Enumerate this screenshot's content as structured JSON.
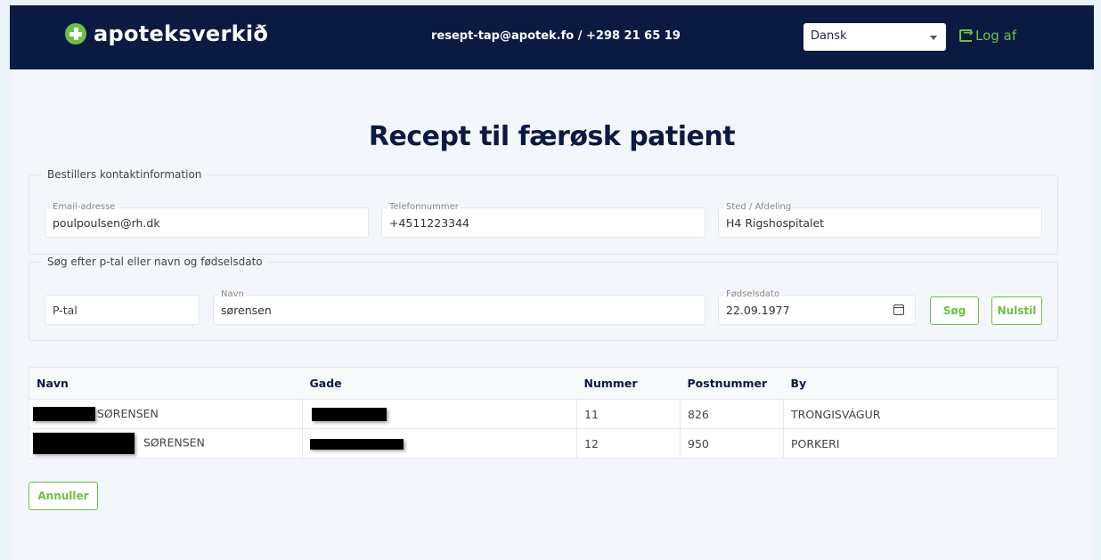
{
  "header": {
    "brand": "apoteksverkið",
    "contact": "resept-tap@apotek.fo / +298 21 65 19",
    "language": "Dansk",
    "logout_label": "Log af"
  },
  "page_title": "Recept til færøsk patient",
  "orderer": {
    "legend": "Bestillers kontaktinformation",
    "email": {
      "label": "Email-adresse",
      "value": "poulpoulsen@rh.dk"
    },
    "phone": {
      "label": "Telefonnummer",
      "value": "+4511223344"
    },
    "department": {
      "label": "Sted / Afdeling",
      "value": "H4 Rigshospitalet"
    }
  },
  "search": {
    "legend": "Søg efter p-tal eller navn og fødselsdato",
    "ptal": {
      "placeholder": "P-tal"
    },
    "name": {
      "label": "Navn",
      "value": "sørensen"
    },
    "birthdate": {
      "label": "Fødselsdato",
      "value": "22.09.1977"
    },
    "search_button": "Søg",
    "reset_button": "Nulstil"
  },
  "results": {
    "columns": [
      "Navn",
      "Gade",
      "Nummer",
      "Postnummer",
      "By"
    ],
    "rows": [
      {
        "name_suffix": "SØRENSEN",
        "number": "11",
        "postcode": "826",
        "city": "TRONGISVÁGUR"
      },
      {
        "name_suffix": "SØRENSEN",
        "number": "12",
        "postcode": "950",
        "city": "PORKERI"
      }
    ]
  },
  "cancel_button": "Annuller",
  "colors": {
    "navy": "#0b1a42",
    "accent": "#6cc04a",
    "background": "#eaf2fa"
  }
}
